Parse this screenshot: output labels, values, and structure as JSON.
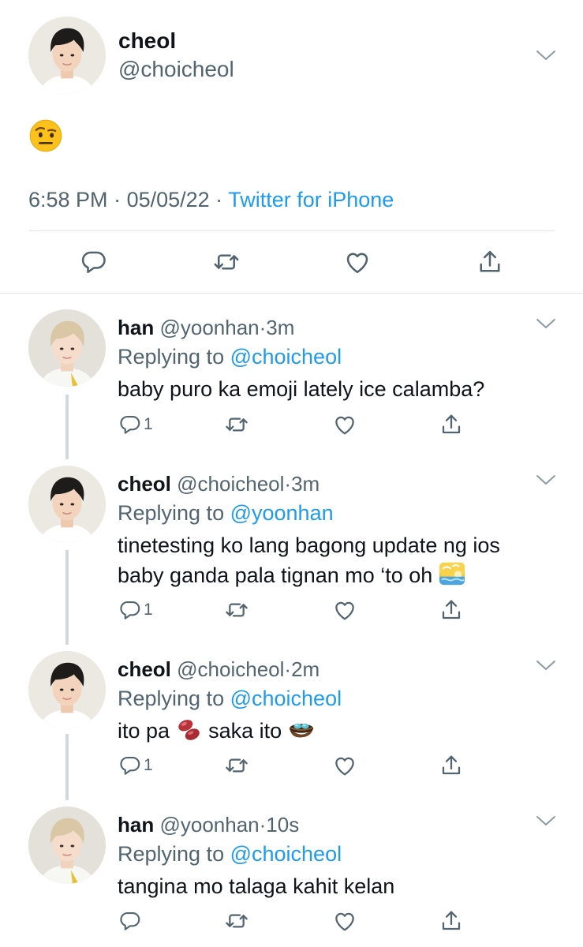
{
  "main_tweet": {
    "name": "cheol",
    "handle": "@choicheol",
    "emoji": "face-with-raised-eyebrow",
    "time": "6:58 PM",
    "separator1": " · ",
    "date": "05/05/22",
    "separator2": " · ",
    "source": "Twitter for iPhone"
  },
  "replies": [
    {
      "name": "han",
      "handle": "@yoonhan",
      "dot": "·",
      "time": "3m",
      "replying_prefix": "Replying to ",
      "replying_to": "@choicheol",
      "text": "baby puro ka emoji lately ice calamba?",
      "reply_count": "1"
    },
    {
      "name": "cheol",
      "handle": "@choicheol",
      "dot": "·",
      "time": "3m",
      "replying_prefix": "Replying to ",
      "replying_to": "@yoonhan",
      "text_line1": "tinetesting ko lang bagong update ng ios",
      "text_line2": "baby ganda pala tignan mo ‘to oh ",
      "emoji": "sunset-image",
      "reply_count": "1"
    },
    {
      "name": "cheol",
      "handle": "@choicheol",
      "dot": "·",
      "time": "2m",
      "replying_prefix": "Replying to ",
      "replying_to": "@choicheol",
      "text_part1": "ito pa ",
      "emoji1": "beans",
      "text_part2": " saka ito ",
      "emoji2": "nest-with-eggs",
      "reply_count": "1"
    },
    {
      "name": "han",
      "handle": "@yoonhan",
      "dot": "·",
      "time": "10s",
      "replying_prefix": "Replying to ",
      "replying_to": "@choicheol",
      "text": "tangina mo talaga kahit kelan",
      "reply_count": ""
    }
  ],
  "colors": {
    "link": "#1d9bf0",
    "secondary": "#536471",
    "divider": "#e1e6ea",
    "thread_line": "#cfd9de"
  }
}
